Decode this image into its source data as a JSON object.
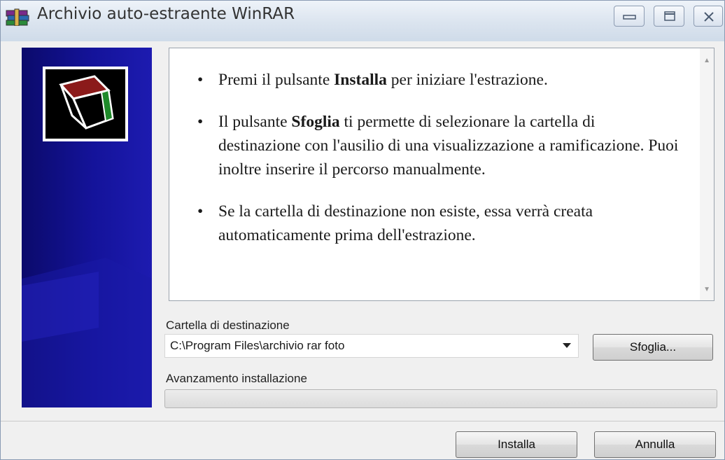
{
  "window": {
    "title": "Archivio auto-estraente WinRAR"
  },
  "instructions": {
    "item1": {
      "before": "Premi il pulsante ",
      "bold": "Installa",
      "after": " per iniziare l'estrazione."
    },
    "item2": {
      "before": "Il pulsante ",
      "bold": "Sfoglia",
      "after": " ti permette di selezionare la cartella di destinazione con l'ausilio di una visualizzazione a ramificazione. Puoi inoltre inserire il percorso manualmente."
    },
    "item3": {
      "text": "Se la cartella di destinazione non esiste, essa verrà creata automaticamente prima dell'estrazione."
    }
  },
  "destination": {
    "label": "Cartella di destinazione",
    "value": "C:\\Program Files\\archivio rar foto",
    "browse_label": "Sfoglia..."
  },
  "progress": {
    "label": "Avanzamento installazione",
    "value_percent": 0
  },
  "buttons": {
    "install_label": "Installa",
    "cancel_label": "Annulla"
  },
  "icons": {
    "app": "winrar-books-icon",
    "logo": "archive-box-icon",
    "minimize": "minimize-icon",
    "maximize": "maximize-icon",
    "close": "close-icon"
  },
  "colors": {
    "side_panel": "#14139a",
    "logo_red": "#8b1a1a",
    "logo_green": "#1f8a2a"
  }
}
